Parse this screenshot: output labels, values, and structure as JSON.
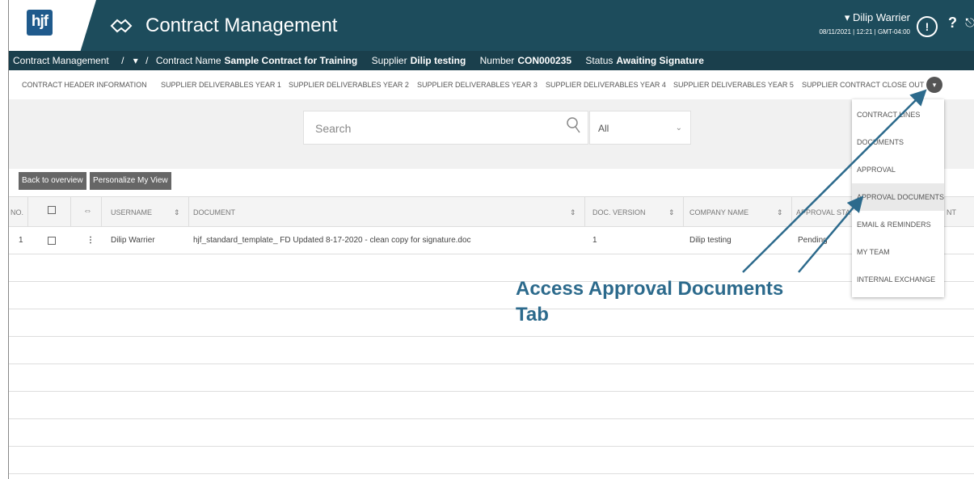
{
  "header": {
    "logo_text": "hjf",
    "app_title": "Contract Management",
    "user_name": "▾ Dilip Warrier",
    "user_datetime": "08/11/2021 | 12:21 | GMT-04:00",
    "help_label": "?",
    "icons": [
      "handshake-icon",
      "user-icon",
      "help-icon",
      "exit-icon"
    ]
  },
  "breadcrumb": {
    "root": "Contract Management",
    "separator": "/",
    "chevron": "▾",
    "contract_name_label": "Contract Name",
    "contract_name_value": "Sample Contract for Training",
    "supplier_label": "Supplier",
    "supplier_value": "Dilip testing",
    "number_label": "Number",
    "number_value": "CON000235",
    "status_label": "Status",
    "status_value": "Awaiting Signature"
  },
  "tabs": [
    "CONTRACT HEADER INFORMATION",
    "SUPPLIER DELIVERABLES YEAR 1",
    "SUPPLIER DELIVERABLES YEAR 2",
    "SUPPLIER DELIVERABLES YEAR 3",
    "SUPPLIER DELIVERABLES YEAR 4",
    "SUPPLIER DELIVERABLES YEAR 5",
    "SUPPLIER CONTRACT CLOSE OUT"
  ],
  "search": {
    "placeholder": "Search",
    "filter_value": "All"
  },
  "buttons": {
    "back": "Back to overview",
    "personalize": "Personalize My View"
  },
  "table": {
    "columns": [
      "NO.",
      "USERNAME",
      "DOCUMENT",
      "DOC. VERSION",
      "COMPANY NAME",
      "APPROVAL STA",
      "NT"
    ],
    "rows": [
      {
        "no": "1",
        "username": "Dilip Warrier",
        "document": "hjf_standard_template_ FD Updated 8-17-2020 - clean copy for signature.doc",
        "doc_version": "1",
        "company": "Dilip testing",
        "approval": "Pending"
      }
    ]
  },
  "dropdown": {
    "items": [
      "CONTRACT LINES",
      "DOCUMENTS",
      "APPROVAL",
      "APPROVAL DOCUMENTS",
      "EMAIL & REMINDERS",
      "MY TEAM",
      "INTERNAL EXCHANGE"
    ],
    "active_index": 3
  },
  "annotation": {
    "line1": "Access Approval Documents",
    "line2": "Tab",
    "color": "#2c6a8c"
  },
  "colors": {
    "header_bg": "#1d4c5c",
    "breadcrumb_bg": "#1a3f4c",
    "button_bg": "#666666"
  }
}
